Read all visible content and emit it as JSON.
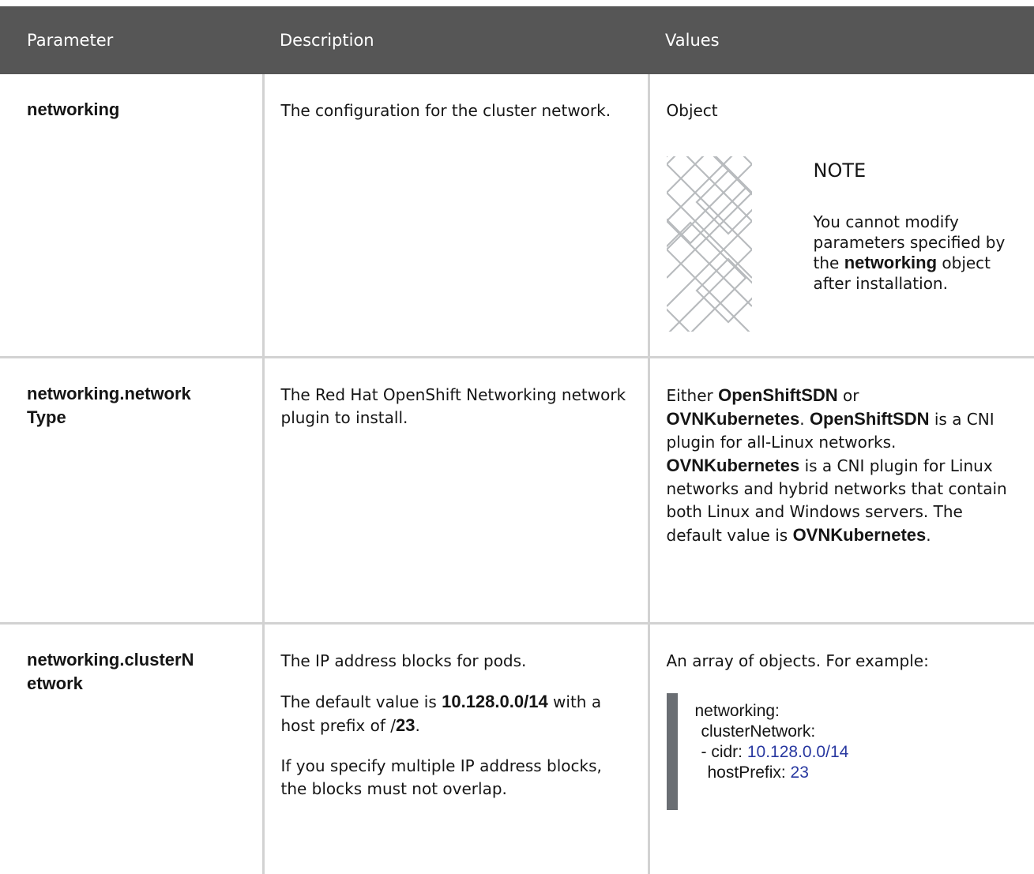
{
  "header": {
    "col1": "Parameter",
    "col2": "Description",
    "col3": "Values"
  },
  "rows": [
    {
      "param": "networking",
      "description": "The configuration for the cluster network.",
      "value": "Object",
      "note": {
        "title": "NOTE",
        "text_before": "You cannot modify parameters specified by the ",
        "bold": "networking",
        "text_after": " object after installation."
      }
    },
    {
      "param_line1": "networking.network",
      "param_line2": "Type",
      "description": "The Red Hat OpenShift Networking network plugin to install.",
      "value": {
        "t1": "Either ",
        "b1": "OpenShiftSDN",
        "t2": " or ",
        "b2": "OVNKubernetes",
        "t3": ". ",
        "b3": "OpenShiftSDN",
        "t4": " is a CNI plugin for all-Linux networks. ",
        "b4": "OVNKubernetes",
        "t5": " is a CNI plugin for Linux networks and hybrid networks that contain both Linux and Windows servers. The default value is ",
        "b5": "OVNKubernetes",
        "t6": "."
      }
    },
    {
      "param_line1": "networking.clusterN",
      "param_line2": "etwork",
      "description": {
        "p1": "The IP address blocks for pods.",
        "p2_t1": "The default value is ",
        "p2_b1": "10.128.0.0/14",
        "p2_t2": " with a host prefix of /",
        "p2_b2": "23",
        "p2_t3": ".",
        "p3": "If you specify multiple IP address blocks, the blocks must not overlap."
      },
      "value": {
        "intro": "An array of objects. For example:",
        "code": {
          "l1": "networking:",
          "l2": "clusterNetwork:",
          "l3_pre": "- cidr: ",
          "l3_num": "10.128.0.0",
          "l3_suffix": "/14",
          "l4_pre": "hostPrefix: ",
          "l4_num": "23"
        }
      }
    }
  ]
}
